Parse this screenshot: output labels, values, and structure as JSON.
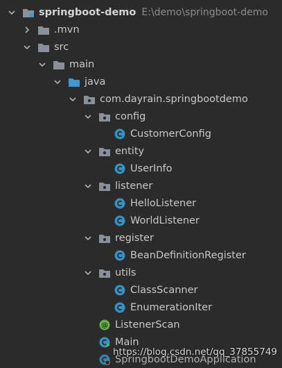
{
  "colors": {
    "background": "#2b2b2b",
    "folder_gray": "#8a9099",
    "folder_blue": "#3c9ad1",
    "class_blue": "#3592c4",
    "annotation_green": "#62b543"
  },
  "project": {
    "name": "springboot-demo",
    "path": "E:\\demo\\springboot-demo"
  },
  "tree": {
    "mvn": ".mvn",
    "src": "src",
    "main": "main",
    "java": "java",
    "package": "com.dayrain.springbootdemo",
    "config": "config",
    "customer_config": "CustomerConfig",
    "entity": "entity",
    "user_info": "UserInfo",
    "listener": "listener",
    "hello_listener": "HelloListener",
    "world_listener": "WorldListener",
    "register": "register",
    "bean_definition_register": "BeanDefinitionRegister",
    "utils": "utils",
    "class_scanner": "ClassScanner",
    "enumeration_iter": "EnumerationIter",
    "listener_scan": "ListenerScan",
    "main_class": "Main",
    "app_class": "SpringbootDemoApplication"
  },
  "watermark": "https://blog.csdn.net/qq_37855749"
}
